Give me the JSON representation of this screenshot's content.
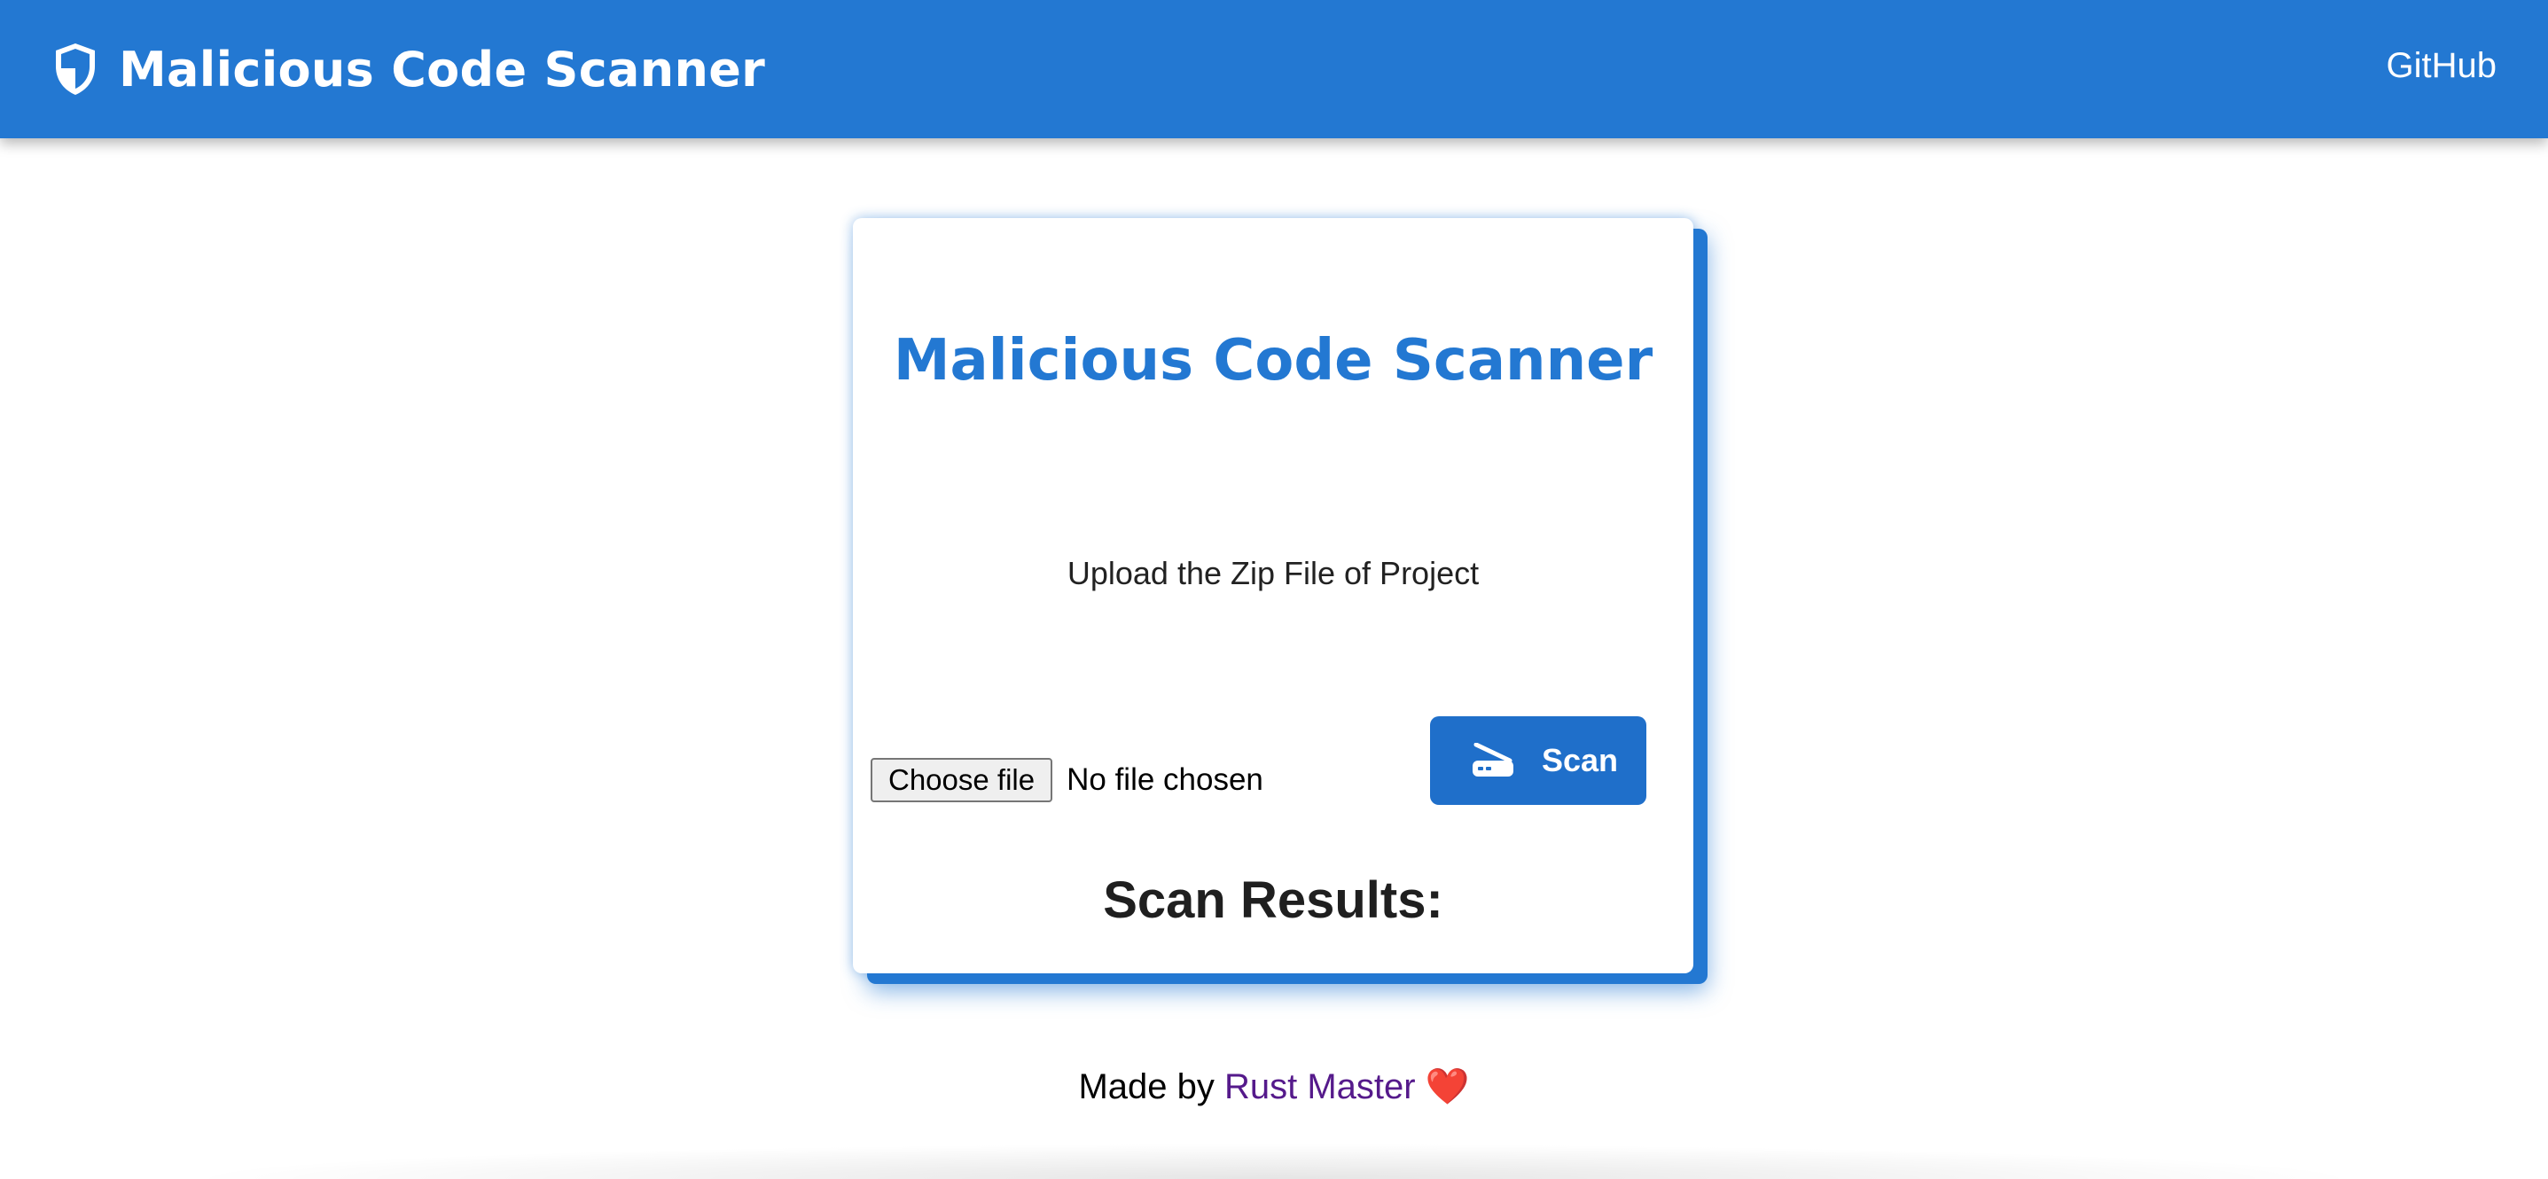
{
  "navbar": {
    "brand_icon": "shield-half-icon",
    "title": "Malicious Code Scanner",
    "github_label": "GitHub",
    "background": "#2378d2"
  },
  "card": {
    "title": "Malicious Code Scanner",
    "upload_label": "Upload the Zip File of Project",
    "file_input": {
      "button_label": "Choose file",
      "status": "No file chosen"
    },
    "scan_button": {
      "icon": "scanner-icon",
      "label": "Scan",
      "color": "#1f6fca"
    },
    "results_heading": "Scan Results:"
  },
  "footer": {
    "prefix": "Made by",
    "author": "Rust Master",
    "heart": "❤️",
    "author_color": "#551a8b"
  }
}
